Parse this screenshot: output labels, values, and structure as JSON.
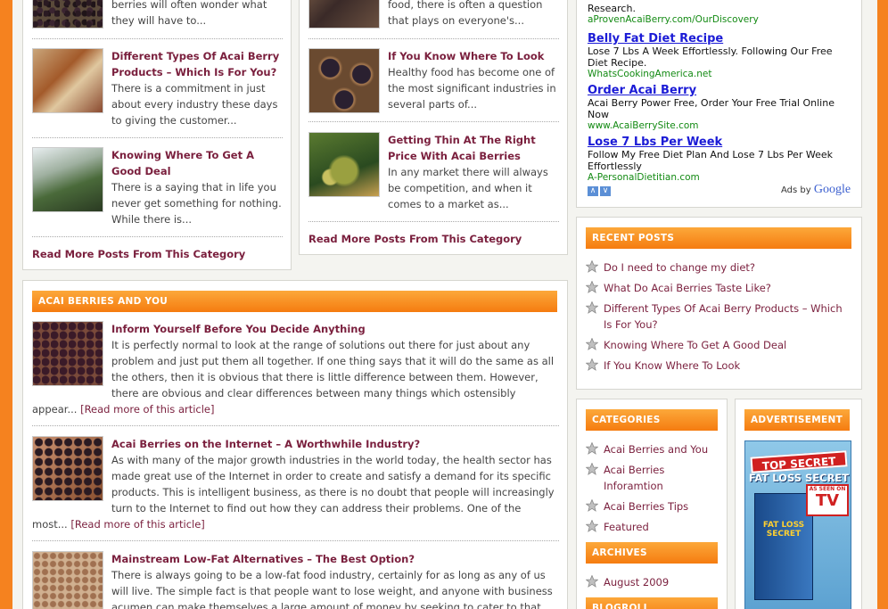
{
  "col1": {
    "top_excerpt": "berries will often wonder what they will have to...",
    "posts": [
      {
        "title": "Different Types Of Acai Berry Products – Which Is For You?",
        "excerpt": "There is a commitment in just about every industry these days to giving the customer..."
      },
      {
        "title": "Knowing Where To Get A Good Deal",
        "excerpt": "There is a saying that in life you never get something for nothing. While there is..."
      }
    ],
    "read_more": "Read More Posts From This Category"
  },
  "col2": {
    "top_excerpt": "food, there is often a question that plays on everyone's...",
    "posts": [
      {
        "title": "If You Know Where To Look",
        "excerpt": "Healthy food has become one of the most significant industries in several parts of..."
      },
      {
        "title": "Getting Thin At The Right Price With Acai Berries",
        "excerpt": "In any market there will always be competition, and when it comes to a market as..."
      }
    ],
    "read_more": "Read More Posts From This Category"
  },
  "acai_section": {
    "header": "Acai Berries and You",
    "read_more_link": "[Read more of this article]",
    "posts": [
      {
        "title": "Inform Yourself Before You Decide Anything",
        "body": "It is perfectly normal to look at the range of solutions out there for just about any problem and just put them all together. If one thing says that it will do the same as all the others, then it is obvious that there is little difference between them. However, there are obvious and clear differences between many things which ostensibly appear... "
      },
      {
        "title": "Acai Berries on the Internet – A Worthwhile Industry?",
        "body": "As with many of the major growth industries in the world today, the health sector has made great use of the Internet in order to create and satisfy a demand for its specific products. This is intelligent business, as there is no doubt that people will increasingly turn to the Internet to find out how they can address their problems. One of the most... "
      },
      {
        "title": "Mainstream Low-Fat Alternatives – The Best Option?",
        "body": "There is always going to be a low-fat food industry, certainly for as long as any of us will live. The simple fact is that people want to lose weight, and anyone with business acumen can make themselves a large amount of money by seeking to cater to that wish. Or, at the very"
      }
    ]
  },
  "ads": {
    "top_partial": "Research.",
    "top_url": "aProvenAcaiBerry.com/OurDiscovery",
    "items": [
      {
        "title": "Belly Fat Diet Recipe",
        "body": "Lose 7 Lbs A Week Effortlessly. Following Our Free Diet Recipe.",
        "url": "WhatsCookingAmerica.net"
      },
      {
        "title": "Order Acai Berry",
        "body": "Acai Berry Power Free, Order Your Free Trial Online Now",
        "url": "www.AcaiBerrySite.com"
      },
      {
        "title": "Lose 7 Lbs Per Week",
        "body": "Follow My Free Diet Plan And Lose 7 Lbs Per Week Effortlessly",
        "url": "A-PersonalDietitian.com"
      }
    ],
    "ads_by": "Ads by",
    "google": "Google"
  },
  "recent_posts": {
    "header": "Recent Posts",
    "items": [
      "Do I need to change my diet?",
      "What Do Acai Berries Taste Like?",
      "Different Types Of Acai Berry Products – Which Is For You?",
      "Knowing Where To Get A Good Deal",
      "If You Know Where To Look"
    ]
  },
  "categories": {
    "header": "Categories",
    "items": [
      "Acai Berries and You",
      "Acai Berries Inforamtion",
      "Acai Berries Tips",
      "Featured"
    ]
  },
  "archives": {
    "header": "Archives",
    "items": [
      "August 2009"
    ]
  },
  "blogroll": {
    "header": "Blogroll"
  },
  "advertisement": {
    "header": "Advertisement",
    "banner_line1": "TOP SECRET",
    "banner_line2": "FAT LOSS SECRET",
    "seen_on": "AS SEEN ON",
    "tv": "TV",
    "book_title": "FAT LOSS SECRET"
  },
  "colors": {
    "accent": "#f5821f",
    "link": "#7a1f3d",
    "ad_title": "#1b1bd6",
    "ad_url": "#138a13"
  },
  "icons": [
    "star-bullet-icon",
    "ad-arrow-up-icon",
    "ad-arrow-down-icon"
  ]
}
